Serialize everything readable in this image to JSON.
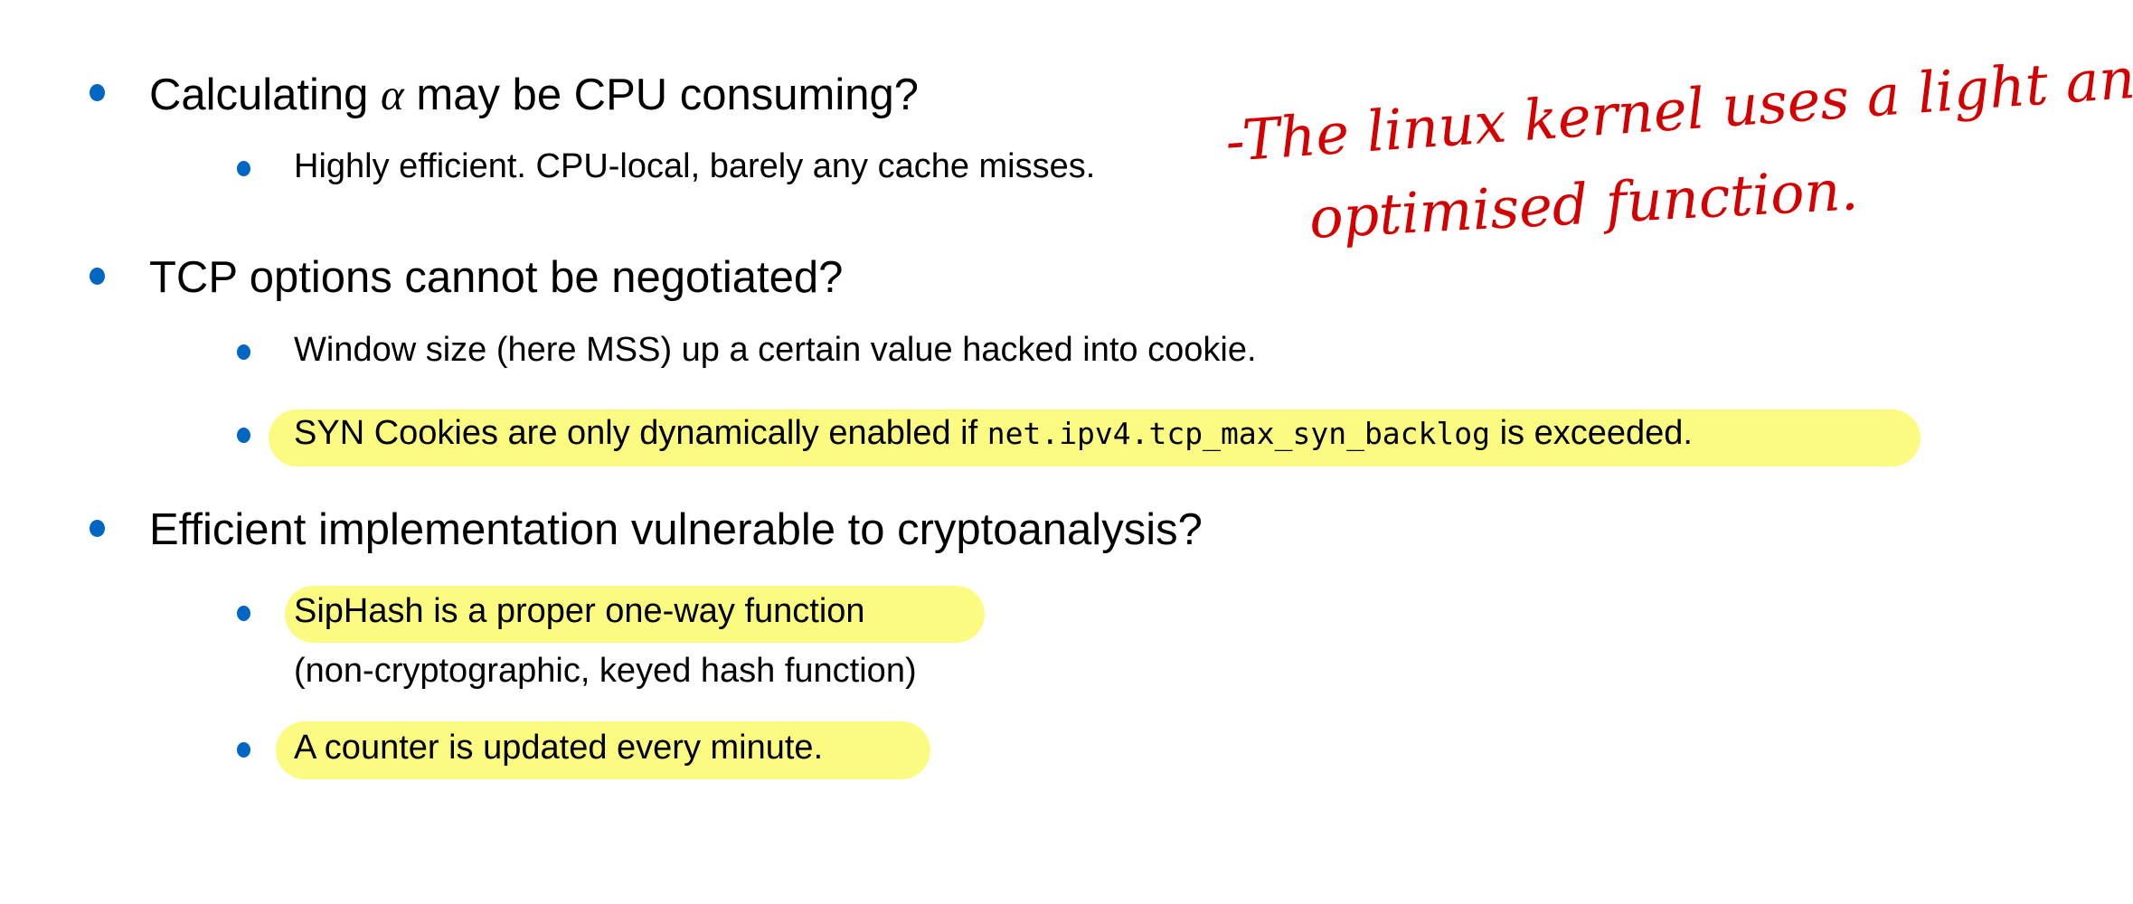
{
  "items": [
    {
      "text_before": "Calculating ",
      "symbol": "α",
      "text_after": " may be CPU consuming?",
      "sub": [
        {
          "text": "Highly efficient. CPU-local, barely any cache misses."
        }
      ]
    },
    {
      "text": "TCP options cannot be negotiated?",
      "sub": [
        {
          "text": "Window size (here MSS) up a certain value hacked into cookie."
        },
        {
          "text_before": "SYN Cookies are only dynamically enabled if ",
          "code": "net.ipv4.tcp_max_syn_backlog",
          "text_after": " is exceeded.",
          "highlighted": true
        }
      ]
    },
    {
      "text": "Efficient implementation vulnerable to cryptoanalysis?",
      "sub": [
        {
          "text": "SipHash is a proper one-way function",
          "continuation": "(non-cryptographic, keyed hash function)",
          "highlighted": true
        },
        {
          "text": "A counter is updated every minute.",
          "highlighted": true
        }
      ]
    }
  ],
  "annotation": {
    "line1": "-The linux kernel uses a light and",
    "line2": "optimised function.",
    "color": "#d40000"
  },
  "colors": {
    "bullet": "#0066c4",
    "highlight": "#fbfb82"
  }
}
